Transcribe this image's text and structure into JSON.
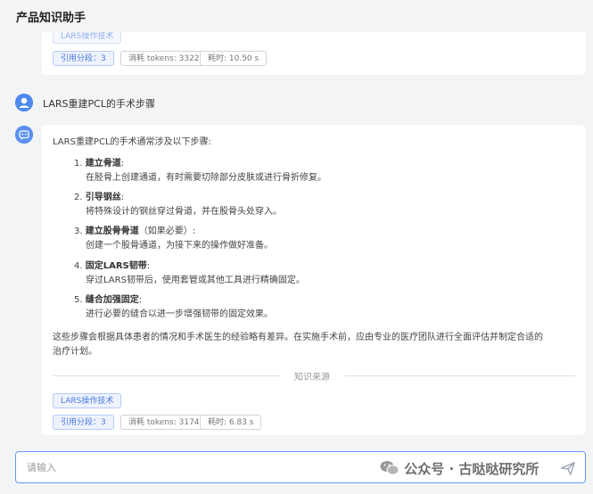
{
  "header": {
    "title": "产品知识助手"
  },
  "prev_answer": {
    "partial_tag": "LARS操作技术",
    "stats": {
      "citations": "引用分段：3",
      "tokens": "消耗 tokens: 3322",
      "time": "耗时: 10.50 s"
    }
  },
  "question": {
    "text": "LARS重建PCL的手术步骤"
  },
  "answer": {
    "intro": "LARS重建PCL的手术通常涉及以下步骤:",
    "steps": [
      {
        "num": "1.",
        "title": "建立骨道",
        "suffix": ":",
        "desc": "在胫骨上创建通道，有时需要切除部分皮肤或进行骨折修复。"
      },
      {
        "num": "2.",
        "title": "引导钢丝",
        "suffix": ":",
        "desc": "将特殊设计的钢丝穿过骨道，并在股骨头处穿入。"
      },
      {
        "num": "3.",
        "title": "建立股骨骨道",
        "suffix": "（如果必要）:",
        "desc": "创建一个股骨通道，为接下来的操作做好准备。"
      },
      {
        "num": "4.",
        "title": "固定LARS韧带",
        "suffix": ":",
        "desc": "穿过LARS韧带后，使用套管或其他工具进行精确固定。"
      },
      {
        "num": "5.",
        "title": "缝合加强固定",
        "suffix": ":",
        "desc": "进行必要的缝合以进一步增强韧带的固定效果。"
      }
    ],
    "conclusion_line1": "这些步骤会根据具体患者的情况和手术医生的经验略有差异。在实施手术前，应由专业的医疗团队进行全面评估并制定合适的",
    "conclusion_line2": "治疗计划。",
    "source_label": "知识来源",
    "source_tag": "LARS操作技术",
    "stats": {
      "citations": "引用分段：3",
      "tokens": "消耗 tokens: 3174",
      "time": "耗时: 6.83 s"
    }
  },
  "input": {
    "placeholder": "请输入"
  },
  "watermark": {
    "text": "公众号 · 古哒哒研究所"
  },
  "colors": {
    "accent": "#4d8af0",
    "tag_border": "#b7cbf6",
    "background": "#f3f4f6"
  },
  "icons": {
    "user": "user-avatar-icon",
    "bot": "robot-icon",
    "send": "send-icon",
    "wechat": "wechat-icon"
  }
}
